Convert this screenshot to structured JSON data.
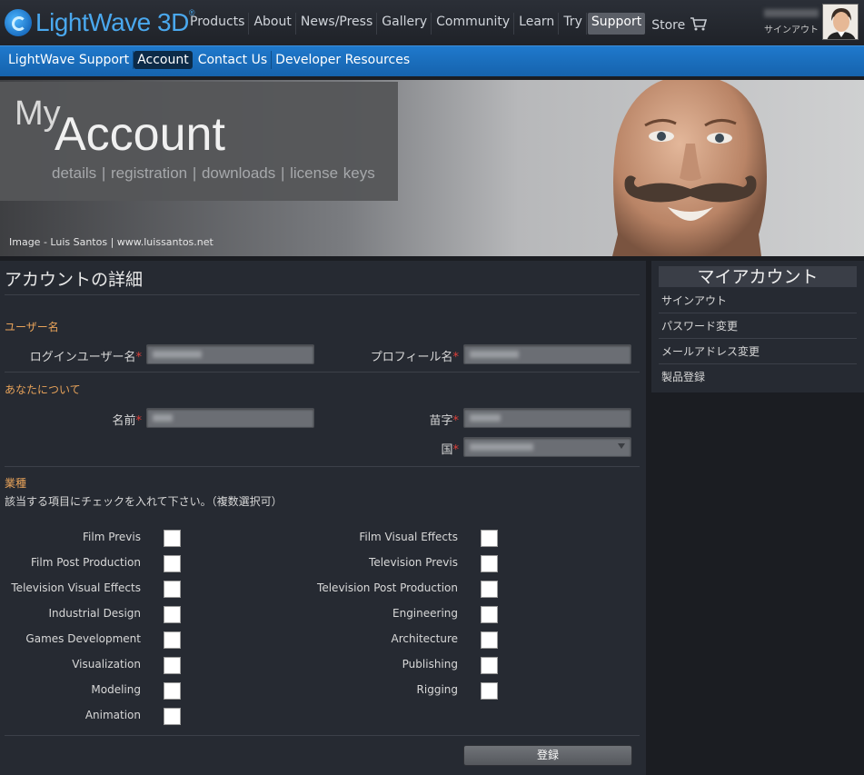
{
  "brand": {
    "name": "LightWave",
    "suffix": " 3D",
    "reg": "®"
  },
  "topnav": {
    "items": [
      {
        "label": "Products"
      },
      {
        "label": "About"
      },
      {
        "label": "News/Press"
      },
      {
        "label": "Gallery"
      },
      {
        "label": "Community"
      },
      {
        "label": "Learn"
      },
      {
        "label": "Try"
      },
      {
        "label": "Support"
      },
      {
        "label": "Store"
      }
    ],
    "active": "Support"
  },
  "user": {
    "signout_label": "サインアウト"
  },
  "subnav": {
    "items": [
      {
        "label": "LightWave Support"
      },
      {
        "label": "Account"
      },
      {
        "label": "Contact Us"
      },
      {
        "label": "Developer Resources"
      }
    ],
    "active": "Account"
  },
  "hero": {
    "my": "My",
    "account": "Account",
    "links": "details | registration | downloads | license keys",
    "credit": "Image - Luis Santos | www.luissantos.net"
  },
  "form": {
    "title": "アカウントの詳細",
    "username_section": "ユーザー名",
    "login_label": "ログインユーザー名",
    "profile_label": "プロフィール名",
    "about_section": "あなたについて",
    "firstname_label": "名前",
    "lastname_label": "苗字",
    "country_label": "国",
    "required_mark": "*",
    "industry_section": "業種",
    "industry_note": "該当する項目にチェックを入れて下さい。（複数選択可）",
    "left_options": [
      "Film Previs",
      "Film Post Production",
      "Television Visual Effects",
      "Industrial Design",
      "Games Development",
      "Visualization",
      "Modeling",
      "Animation"
    ],
    "right_options": [
      "Film Visual Effects",
      "Television Previs",
      "Television Post Production",
      "Engineering",
      "Architecture",
      "Publishing",
      "Rigging"
    ],
    "submit_label": "登録"
  },
  "sidebar": {
    "title": "マイアカウント",
    "items": [
      "サインアウト",
      "パスワード変更",
      "メールアドレス変更",
      "製品登録"
    ]
  }
}
